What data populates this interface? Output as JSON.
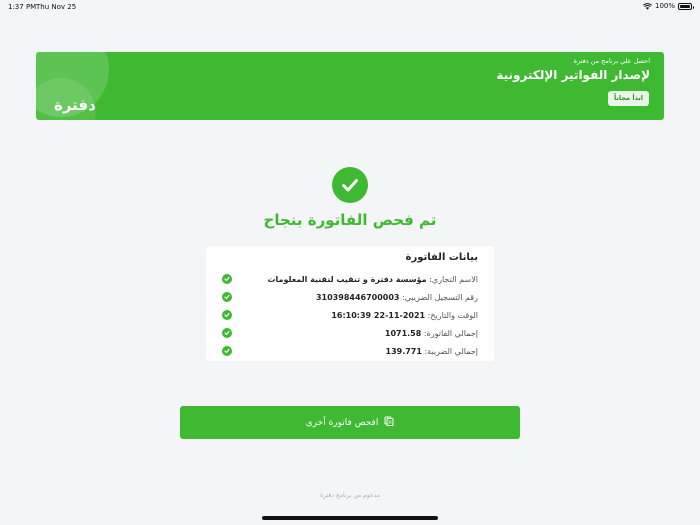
{
  "status_bar": {
    "time": "1:37 PM",
    "date": "Thu Nov 25",
    "battery": "100%"
  },
  "banner": {
    "subtitle": "احصل علي برنامج من دفترة",
    "title": "لإصدار الفواتير الإلكترونية",
    "cta": "ابدأ مجاناً",
    "logo": "دفترة",
    "color": "#3fb832"
  },
  "result": {
    "title": "تم فحص الفاتورة بنجاح",
    "icon": "check-circle-icon"
  },
  "invoice": {
    "title": "بيانات الفاتورة",
    "rows": [
      {
        "label": "الاسم التجاري:",
        "value": "مؤسسة دفترة و تنقيب لتقنية المعلومات"
      },
      {
        "label": "رقم التسجيل الضريبي:",
        "value": "310398446700003"
      },
      {
        "label": "الوقت والتاريخ:",
        "value": "2021-11-22 16:10:39"
      },
      {
        "label": "إجمالي الفاتورة:",
        "value": "1071.58"
      },
      {
        "label": "إجمالي الضريبة:",
        "value": "139.771"
      }
    ]
  },
  "action_button": {
    "label": "افحص فاتورة أخرى",
    "icon": "scan-document-icon"
  },
  "footer": {
    "text": "مدعوم من برنامج دفترة"
  }
}
